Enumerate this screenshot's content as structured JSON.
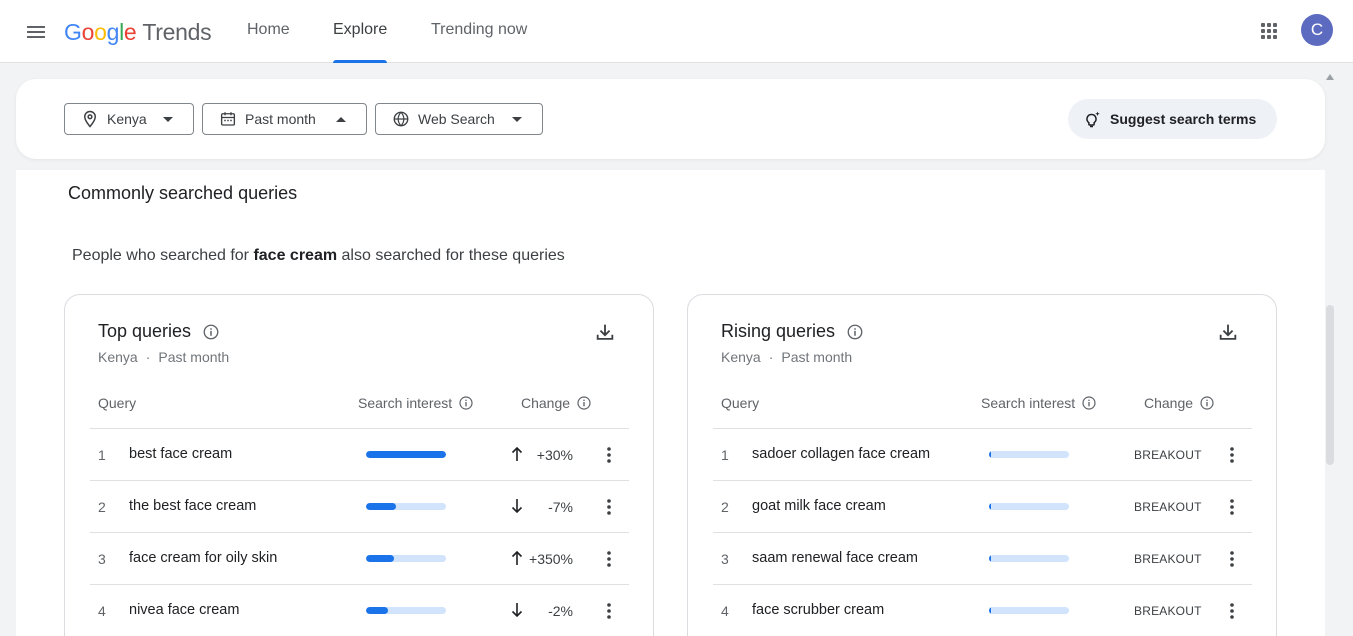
{
  "header": {
    "logo_letters": [
      "G",
      "o",
      "o",
      "g",
      "l",
      "e"
    ],
    "logo_product": "Trends",
    "nav": [
      {
        "label": "Home",
        "active": false
      },
      {
        "label": "Explore",
        "active": true
      },
      {
        "label": "Trending now",
        "active": false
      }
    ],
    "avatar_letter": "C",
    "avatar_color": "#5c6bc0",
    "icons": [
      "menu-icon",
      "apps-grid-icon"
    ]
  },
  "filters": {
    "location": "Kenya",
    "time_range": "Past month",
    "search_type": "Web Search",
    "suggest_label": "Suggest search terms",
    "icons": [
      "location-pin-icon",
      "calendar-icon",
      "globe-icon",
      "lightbulb-icon"
    ]
  },
  "main": {
    "section_title": "Commonly searched queries",
    "desc_prefix": "People who searched for ",
    "desc_term": "face cream",
    "desc_suffix": " also searched for these queries"
  },
  "top_queries": {
    "title": "Top queries",
    "location": "Kenya",
    "separator": "·",
    "time_range": "Past month",
    "col_query": "Query",
    "col_interest": "Search interest",
    "col_change": "Change",
    "rows": [
      {
        "rank": "1",
        "query": "best face cream",
        "interest": 100,
        "direction": "up",
        "change": "+30%"
      },
      {
        "rank": "2",
        "query": "the best face cream",
        "interest": 38,
        "direction": "down",
        "change": "-7%"
      },
      {
        "rank": "3",
        "query": "face cream for oily skin",
        "interest": 35,
        "direction": "up",
        "change": "+350%"
      },
      {
        "rank": "4",
        "query": "nivea face cream",
        "interest": 28,
        "direction": "down",
        "change": "-2%"
      }
    ]
  },
  "rising_queries": {
    "title": "Rising queries",
    "location": "Kenya",
    "separator": "·",
    "time_range": "Past month",
    "col_query": "Query",
    "col_interest": "Search interest",
    "col_change": "Change",
    "rows": [
      {
        "rank": "1",
        "query": "sadoer collagen face cream",
        "interest": 3,
        "change": "BREAKOUT"
      },
      {
        "rank": "2",
        "query": "goat milk face cream",
        "interest": 3,
        "change": "BREAKOUT"
      },
      {
        "rank": "3",
        "query": "saam renewal face cream",
        "interest": 3,
        "change": "BREAKOUT"
      },
      {
        "rank": "4",
        "query": "face scrubber cream",
        "interest": 3,
        "change": "BREAKOUT"
      }
    ]
  },
  "colors": {
    "accent": "#1a73e8",
    "bar_track": "#d2e3fc",
    "page_bg": "#f1f3f4"
  }
}
